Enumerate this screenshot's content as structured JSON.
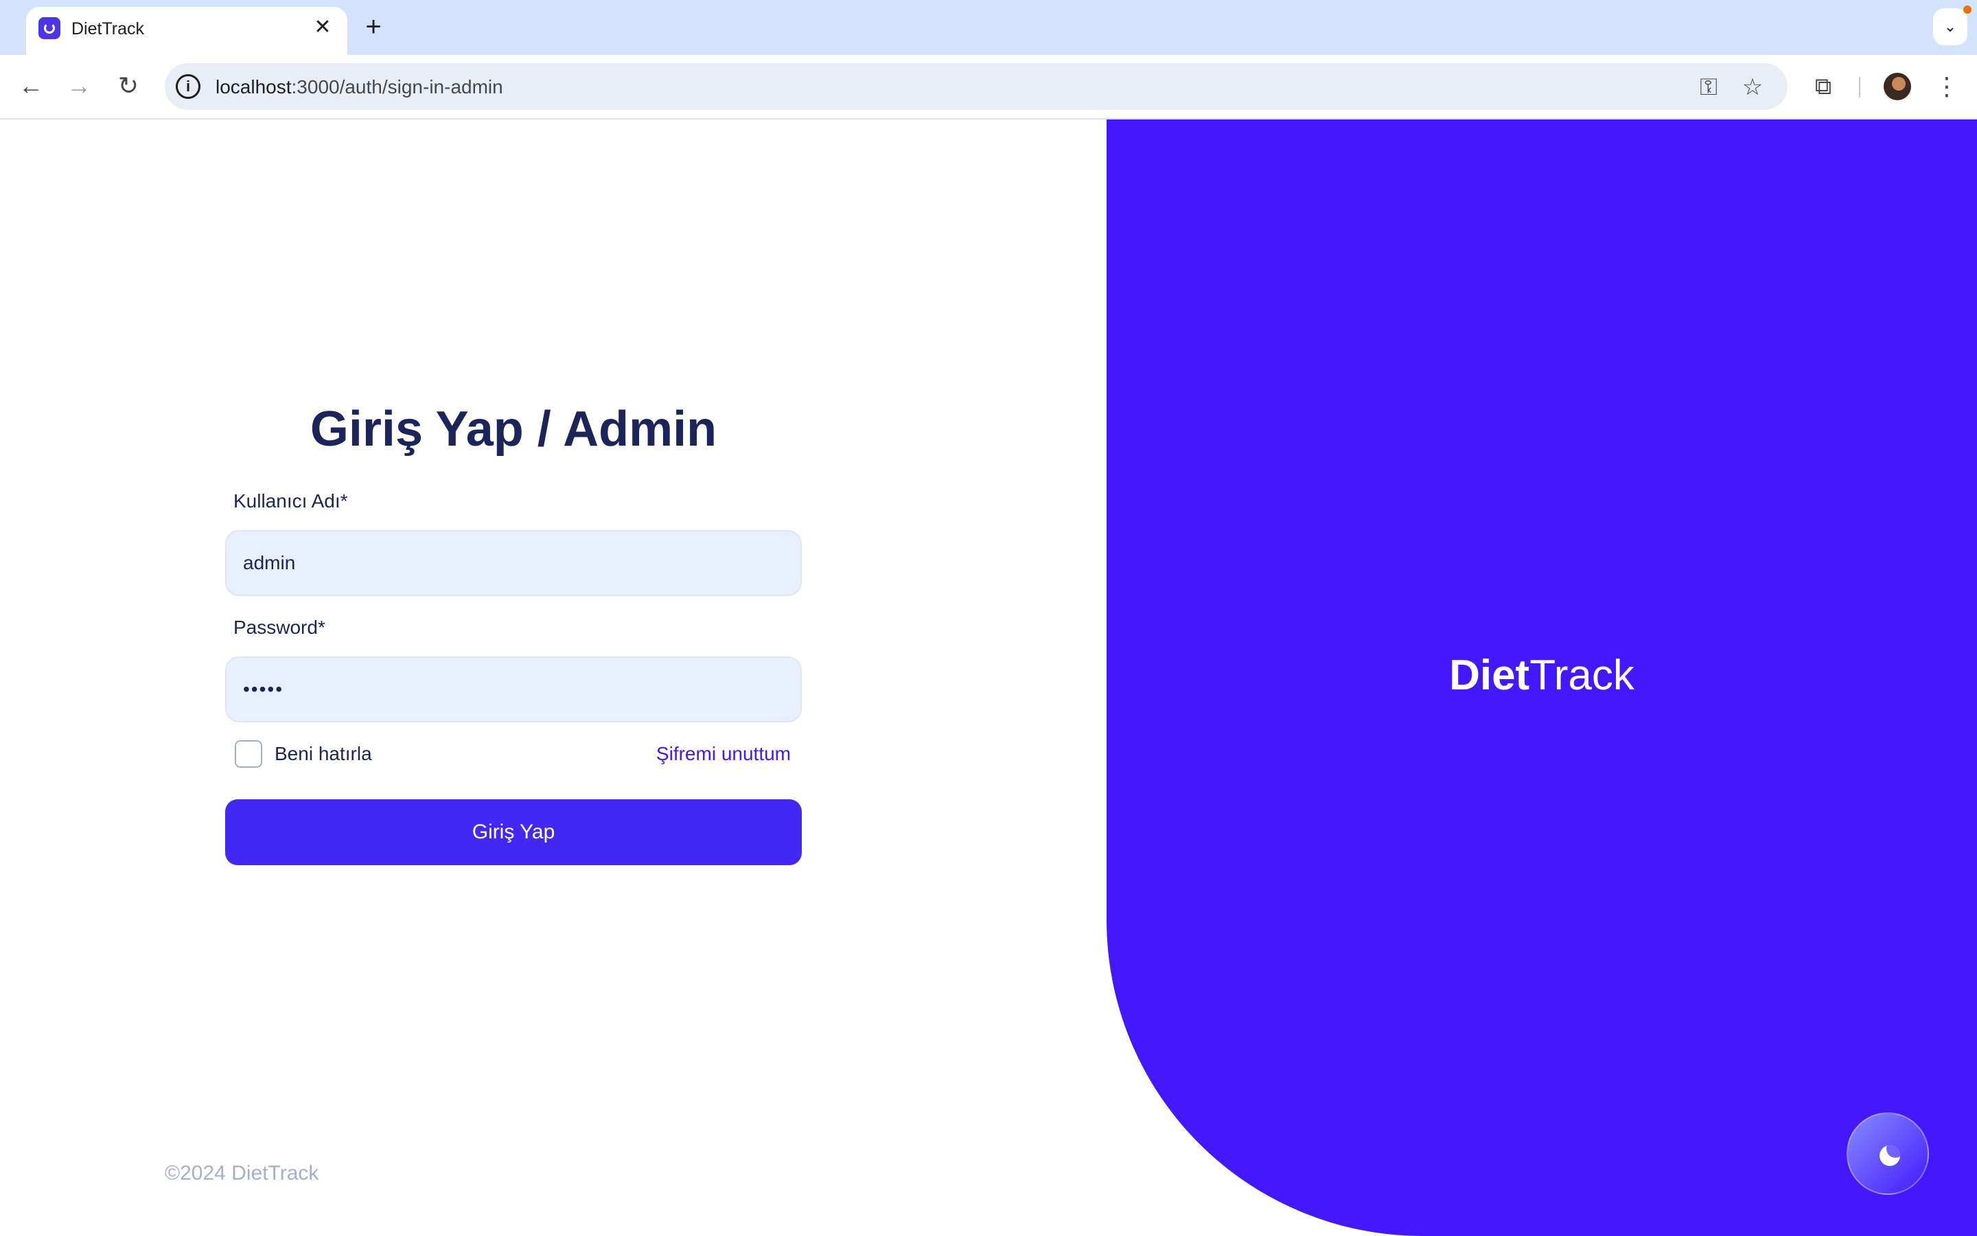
{
  "browser": {
    "tab_title": "DietTrack",
    "tab_close": "✕",
    "new_tab": "+",
    "tab_menu": "⌄",
    "url_host": "localhost",
    "url_path": ":3000/auth/sign-in-admin",
    "icons": {
      "back": "←",
      "forward": "→",
      "reload": "↻",
      "site_info": "i",
      "key": "⚿",
      "star": "☆",
      "extensions": "⧉",
      "menu": "⋮"
    }
  },
  "login": {
    "title": "Giriş Yap / Admin",
    "username_label": "Kullanıcı Adı*",
    "username_value": "admin",
    "password_label": "Password*",
    "password_value": "•••••",
    "remember_label": "Beni hatırla",
    "remember_checked": false,
    "forgot_link": "Şifremi unuttum",
    "submit_label": "Giriş Yap"
  },
  "brand": {
    "logo_bold": "Diet",
    "logo_light": "Track",
    "panel_color": "#4318ff"
  },
  "footer": {
    "copyright": "©2024 DietTrack"
  },
  "theme_toggle": {
    "icon": "moon-icon"
  }
}
